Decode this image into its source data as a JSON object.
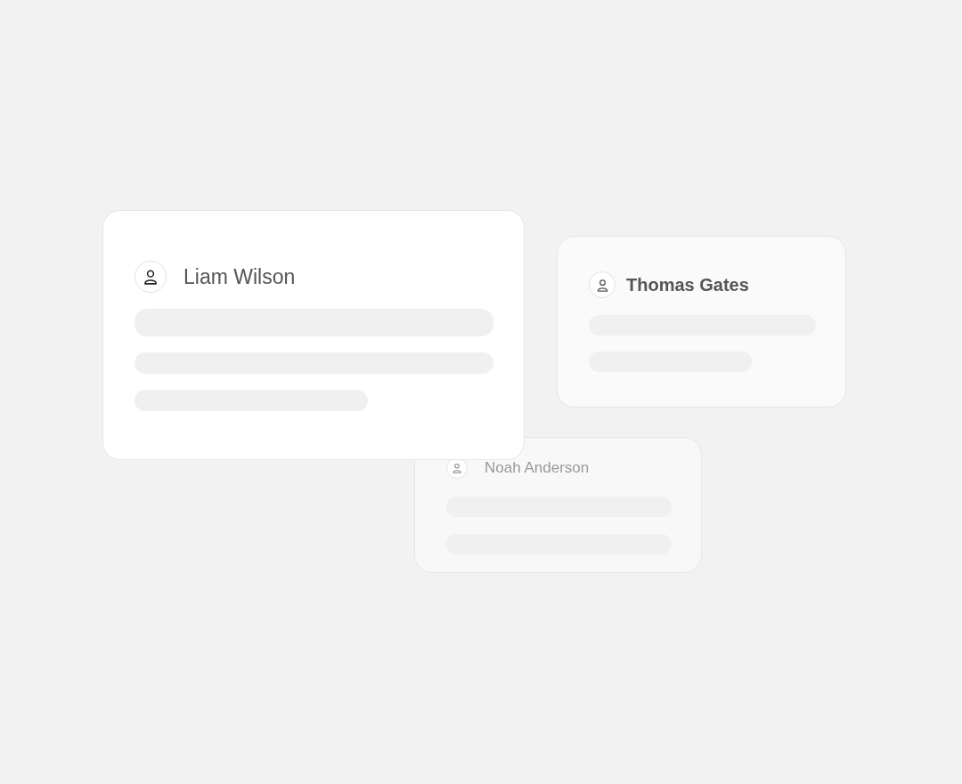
{
  "cards": [
    {
      "kind": "back",
      "name": "Noah Anderson"
    },
    {
      "kind": "side",
      "name": "Thomas Gates"
    },
    {
      "kind": "front",
      "name": "Liam Wilson"
    }
  ]
}
